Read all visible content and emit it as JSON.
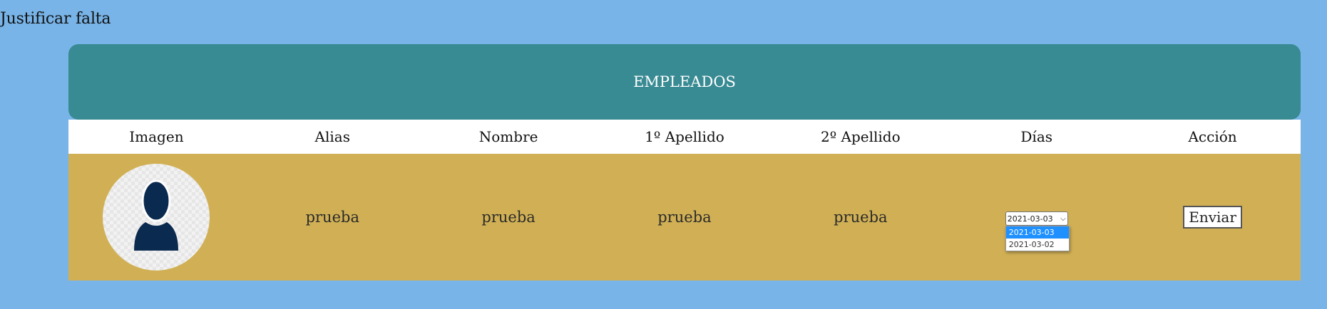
{
  "page": {
    "heading": "Justificar falta"
  },
  "panel": {
    "title": "EMPLEADOS",
    "columns": [
      "Imagen",
      "Alias",
      "Nombre",
      "1º Apellido",
      "2º Apellido",
      "Días",
      "Acción"
    ]
  },
  "rows": [
    {
      "avatar_icon": "user-silhouette-icon",
      "alias": "prueba",
      "nombre": "prueba",
      "apellido1": "prueba",
      "apellido2": "prueba",
      "dias": {
        "selected": "2021-03-03",
        "options": [
          "2021-03-03",
          "2021-03-02"
        ]
      },
      "action_label": "Enviar"
    }
  ],
  "colors": {
    "background": "#78b4e8",
    "header": "#388a93",
    "row": "#d1b055",
    "avatar": "#0a2a4f",
    "selected_option": "#1e90ff"
  }
}
